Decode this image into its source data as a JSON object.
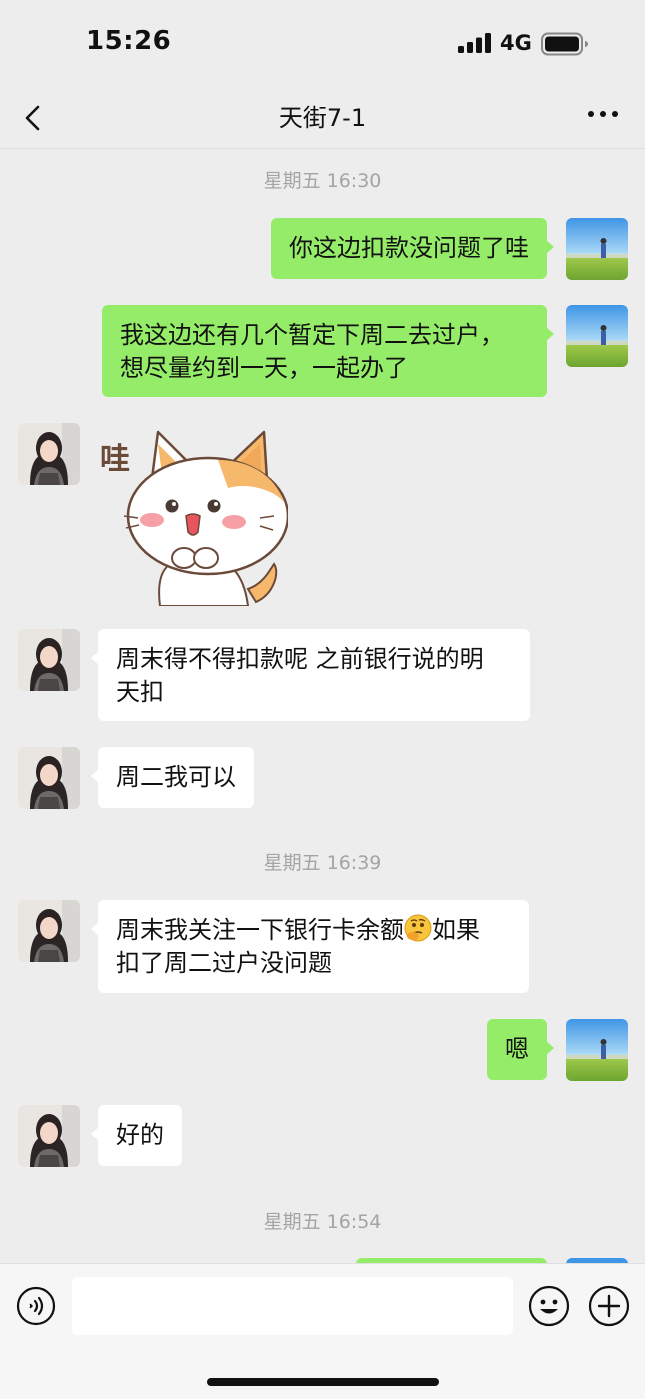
{
  "status_bar": {
    "time": "15:26",
    "network": "4G"
  },
  "nav": {
    "title": "天街7-1"
  },
  "timestamps": [
    "星期五 16:30",
    "星期五 16:39",
    "星期五 16:54"
  ],
  "messages": [
    {
      "side": "sent",
      "text": "你这边扣款没问题了哇"
    },
    {
      "side": "sent",
      "text": "我这边还有几个暂定下周二去过户，\n想尽量约到一天，一起办了"
    },
    {
      "side": "recv",
      "type": "sticker",
      "text": "哇"
    },
    {
      "side": "recv",
      "text": "周末得不得扣款呢 之前银行说的明\n天扣"
    },
    {
      "side": "recv",
      "text": "周二我可以"
    },
    {
      "side": "recv",
      "text_before": "周末我关注一下银行卡余额",
      "emoji": "thinking-face",
      "text_after": "如果\n扣了周二过户没问题"
    },
    {
      "side": "sent",
      "text": "嗯"
    },
    {
      "side": "recv",
      "text": "好的"
    }
  ],
  "input": {
    "placeholder": "",
    "value": ""
  },
  "icons": {
    "back": "chevron-left-icon",
    "more": "more-dots-icon",
    "voice": "voice-icon",
    "emoji": "emoji-icon",
    "plus": "plus-icon"
  },
  "colors": {
    "sent_bubble": "#95ec69",
    "recv_bubble": "#ffffff",
    "background": "#ededed",
    "timestamp": "#a4a4a4"
  }
}
